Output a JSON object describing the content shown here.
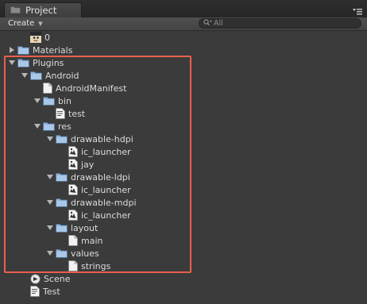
{
  "panel": {
    "tab_title": "Project"
  },
  "toolbar": {
    "create_label": "Create",
    "search_placeholder": "All"
  },
  "tree": [
    {
      "label": "0",
      "icon": "avatar-icon",
      "expander": "none"
    },
    {
      "label": "Materials",
      "icon": "folder-icon",
      "expander": "collapsed"
    },
    {
      "label": "Plugins",
      "icon": "folder-icon",
      "expander": "expanded"
    },
    {
      "label": "Android",
      "icon": "folder-icon",
      "expander": "expanded"
    },
    {
      "label": "AndroidManifest",
      "icon": "file-icon",
      "expander": "none"
    },
    {
      "label": "bin",
      "icon": "folder-icon",
      "expander": "expanded"
    },
    {
      "label": "test",
      "icon": "script-icon",
      "expander": "none"
    },
    {
      "label": "res",
      "icon": "folder-icon",
      "expander": "expanded"
    },
    {
      "label": "drawable-hdpi",
      "icon": "folder-icon",
      "expander": "expanded"
    },
    {
      "label": "ic_launcher",
      "icon": "image-icon",
      "expander": "none"
    },
    {
      "label": "jay",
      "icon": "image-icon",
      "expander": "none"
    },
    {
      "label": "drawable-ldpi",
      "icon": "folder-icon",
      "expander": "expanded"
    },
    {
      "label": "ic_launcher",
      "icon": "image-icon",
      "expander": "none"
    },
    {
      "label": "drawable-mdpi",
      "icon": "folder-icon",
      "expander": "expanded"
    },
    {
      "label": "ic_launcher",
      "icon": "image-icon",
      "expander": "none"
    },
    {
      "label": "layout",
      "icon": "folder-icon",
      "expander": "expanded"
    },
    {
      "label": "main",
      "icon": "file-icon",
      "expander": "none"
    },
    {
      "label": "values",
      "icon": "folder-icon",
      "expander": "expanded"
    },
    {
      "label": "strings",
      "icon": "file-icon",
      "expander": "none"
    },
    {
      "label": "Scene",
      "icon": "unity-scene-icon",
      "expander": "none"
    },
    {
      "label": "Test",
      "icon": "script-icon",
      "expander": "none"
    }
  ],
  "colors": {
    "highlight_border": "#e9604c",
    "folder": "#8fb4dc",
    "background": "#3b3b3b"
  }
}
